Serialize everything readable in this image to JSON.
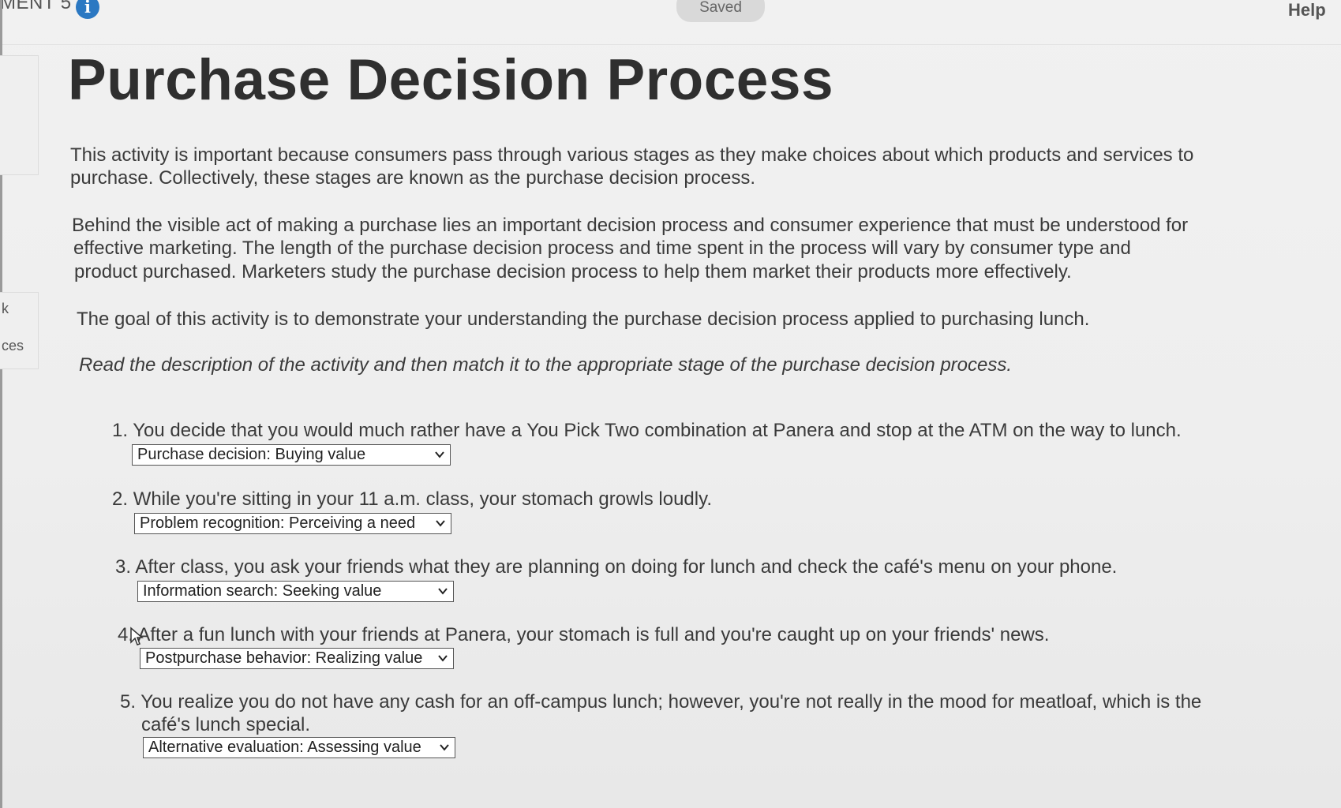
{
  "topbar": {
    "assignment_label": "MENT 5",
    "info_icon_glyph": "i",
    "saved_label": "Saved",
    "help_label": "Help"
  },
  "side": {
    "label_k": "k",
    "label_ces": "ces"
  },
  "title": "Purchase Decision Process",
  "paragraphs": {
    "p1_line1": "This activity is important because consumers pass through various stages as they make choices about which products and services to",
    "p1_line2": "purchase. Collectively, these stages are known as the purchase decision process.",
    "p2_line1": "Behind the visible act of making a purchase lies an important decision process and consumer experience that must be understood for",
    "p2_line2": "effective marketing. The length of the purchase decision process and time spent in the process will vary by consumer type and",
    "p2_line3": "product purchased. Marketers study the purchase decision process to help them market their products more effectively.",
    "p3": "The goal of this activity is to demonstrate your understanding the purchase decision process applied to purchasing lunch.",
    "instructions": "Read the description of the activity and then match it to the appropriate stage of the purchase decision process."
  },
  "questions": [
    {
      "number": "1.",
      "text": "You decide that you would much rather have a You Pick Two combination at Panera and stop at the ATM on the way to lunch.",
      "selected": "Purchase decision: Buying value"
    },
    {
      "number": "2.",
      "text": "While you're sitting in your 11 a.m. class, your stomach growls loudly.",
      "selected": "Problem recognition: Perceiving a need"
    },
    {
      "number": "3.",
      "text": "After class, you ask your friends what they are planning on doing for lunch and check the café's menu on your phone.",
      "selected": "Information search: Seeking value"
    },
    {
      "number": "4.",
      "text": "After a fun lunch with your friends at Panera, your stomach is full and you're caught up on your friends' news.",
      "selected": "Postpurchase behavior: Realizing value"
    },
    {
      "number": "5.",
      "text_line1": "You realize you do not have any cash for an off-campus lunch; however, you're not really in the mood for meatloaf, which is the",
      "text_line2": "café's lunch special.",
      "selected": "Alternative evaluation: Assessing value"
    }
  ],
  "icons": {
    "info": "info-icon",
    "dropdown": "chevron-down-icon",
    "pointer": "pointer-cursor-icon"
  },
  "colors": {
    "info_icon": "#2b78c2",
    "saved_pill": "#d9d9d9"
  }
}
